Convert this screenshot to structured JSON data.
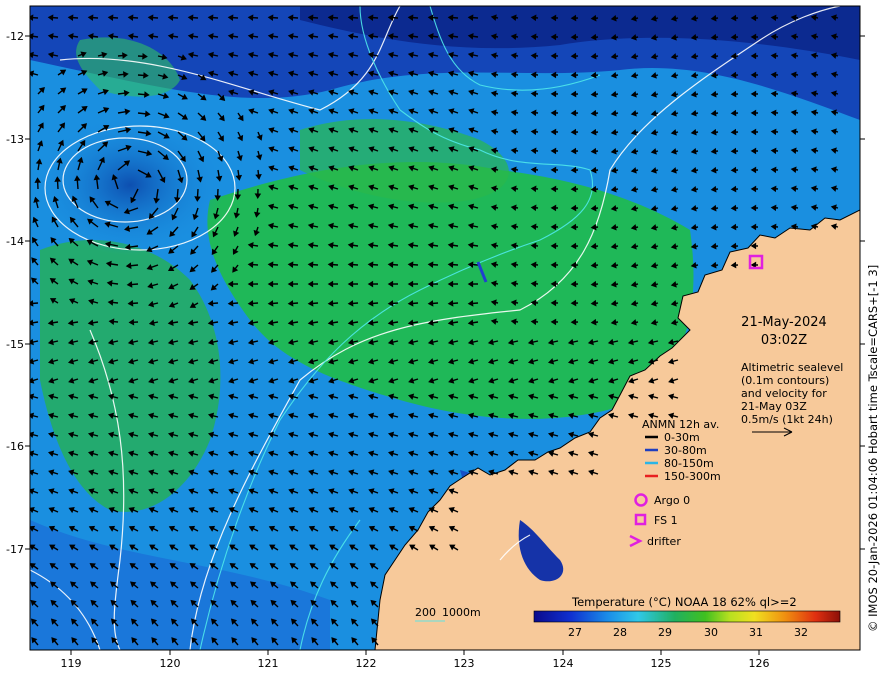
{
  "date_line": "21-May-2024",
  "time_line": "03:02Z",
  "altimetry_text": [
    "Altimetric sealevel",
    "(0.1m contours)",
    "and velocity for",
    "21-May 03Z",
    "0.5m/s (1kt 24h)"
  ],
  "anmn": {
    "title": "ANMN 12h av.",
    "items": [
      {
        "label": "0-30m",
        "color": "#000000"
      },
      {
        "label": "30-80m",
        "color": "#1f3fbf"
      },
      {
        "label": "80-150m",
        "color": "#2bb5e6"
      },
      {
        "label": "150-300m",
        "color": "#e82020"
      }
    ]
  },
  "markers": {
    "argo": "Argo 0",
    "fs": "FS 1",
    "drifter": "drifter",
    "color": "#e020e0"
  },
  "colorbar": {
    "title": "Temperature (°C) NOAA 18 62% ql>=2",
    "ticks": [
      "27",
      "28",
      "29",
      "30",
      "31",
      "32"
    ]
  },
  "depth_legend": {
    "a": "200",
    "b": "1000m"
  },
  "x_ticks": [
    "119",
    "120",
    "121",
    "122",
    "123",
    "124",
    "125",
    "126"
  ],
  "y_ticks": [
    "-12",
    "-13",
    "-14",
    "-15",
    "-16",
    "-17"
  ],
  "side_caption": "© IMOS 20-Jan-2026 01:04:06 Hobart time Tscale=CARS+[-1 3]",
  "colors": {
    "land": "#f7c99a",
    "ocean_deep": "#1e3fa8",
    "ocean_mid": "#1aa0e8",
    "warm": "#21c040"
  }
}
